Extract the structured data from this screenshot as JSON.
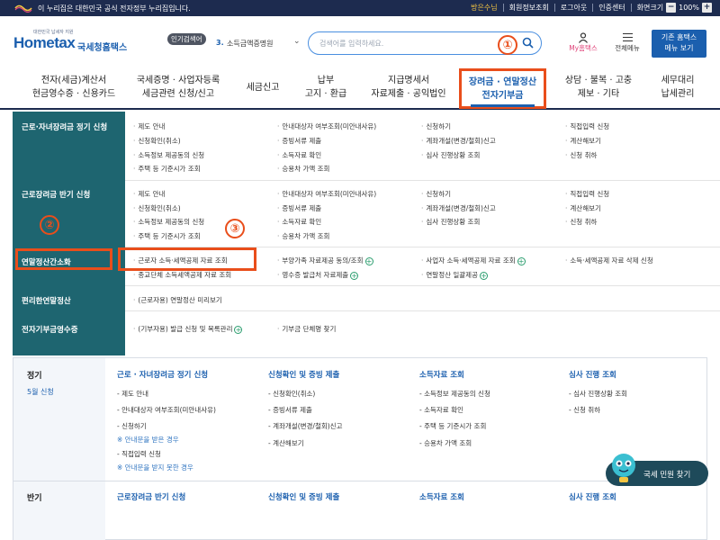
{
  "govbar": {
    "text": "이 누리집은 대한민국 공식 전자정부 누리집입니다.",
    "user": "방은수님",
    "links": [
      "회원정보조회",
      "로그아웃",
      "인증센터",
      "화면크기"
    ],
    "zoom": "100%",
    "zoom_minus": "−",
    "zoom_plus": "+"
  },
  "logo": {
    "small": "대한민국 납세자 지원",
    "home": "Hometax",
    "name": "국세청홈택스"
  },
  "popular": {
    "tag": "인기검색어",
    "rank": "3.",
    "item": "소득금액증명원"
  },
  "search": {
    "placeholder": "검색어를 입력하세요."
  },
  "markers": {
    "m1": "①",
    "m2": "②",
    "m3": "③"
  },
  "header": {
    "myhome": "My홈택스",
    "allmenu": "전체메뉴",
    "basic_line1": "기존 홈택스",
    "basic_line2": "메뉴 보기"
  },
  "gnb": {
    "items": [
      {
        "l1": "전자(세금)계산서",
        "l2": "현금영수증 · 신용카드"
      },
      {
        "l1": "국세증명 · 사업자등록",
        "l2": "세금관련 신청/신고"
      },
      {
        "l1": "세금신고",
        "l2": ""
      },
      {
        "l1": "납부",
        "l2": "고지 · 환급"
      },
      {
        "l1": "지급명세서",
        "l2": "자료제출 · 공익법인"
      },
      {
        "l1": "장려금 · 연말정산",
        "l2": "전자기부금"
      },
      {
        "l1": "상담 · 불복 · 고충",
        "l2": "제보 · 기타"
      },
      {
        "l1": "세무대리",
        "l2": "납세관리"
      }
    ]
  },
  "menu": {
    "sections": [
      {
        "title": "근로·자녀장려금 정기 신청",
        "col1": [
          "제도 안내",
          "신청확인(취소)",
          "소득정보 제공동의 신청",
          "주택 등 기준시가 조회"
        ],
        "col2": [
          "안내대상자 여부조회(미안내사유)",
          "증빙서류 제출",
          "소득자료 확인",
          "승용차 가액 조회"
        ],
        "col3": [
          "신청하기",
          "계좌개설(변경/철회)신고",
          "심사 진행상황 조회"
        ],
        "col4": [
          "직접입력 신청",
          "계산해보기",
          "신청 취하"
        ]
      },
      {
        "title": "근로장려금 반기 신청",
        "col1": [
          "제도 안내",
          "신청확인(취소)",
          "소득정보 제공동의 신청",
          "주택 등 기준시가 조회"
        ],
        "col2": [
          "안내대상자 여부조회(미안내사유)",
          "증빙서류 제출",
          "소득자료 확인",
          "승용차 가액 조회"
        ],
        "col3": [
          "신청하기",
          "계좌개설(변경/철회)신고",
          "심사 진행상황 조회"
        ],
        "col4": [
          "직접입력 신청",
          "계산해보기",
          "신청 취하"
        ]
      },
      {
        "title": "연말정산간소화",
        "col1": [
          "근로자 소득·세액공제 자료 조회",
          "종교단체 소득세액공제 자료 조회"
        ],
        "col2": [
          "부양가족 자료제공 동의/조회",
          "영수증 발급처 자료제출"
        ],
        "col3": [
          "사업자 소득·세액공제 자료 조회",
          "연말정산 일괄제공"
        ],
        "col4": [
          "소득·세액공제 자료 삭제 신청"
        ]
      },
      {
        "title": "편리한연말정산",
        "col1": [
          "(근로자용) 연말정산 미리보기"
        ]
      },
      {
        "title": "전자기부금영수증",
        "col1": [
          "(기부자용) 발급 신청 및 목록관리"
        ],
        "col2": [
          "기부금 단체명 찾기"
        ]
      }
    ]
  },
  "lower": {
    "regular": {
      "label": "정기",
      "sub": "5월 신청"
    },
    "half": {
      "label": "반기"
    },
    "cols": [
      {
        "head": "근로 · 자녀장려금 정기 신청",
        "items": [
          "제도 안내",
          "안내대상자 여부조회(미안내사유)",
          "신청하기"
        ],
        "note1": "※ 안내문을 받은 경우",
        "item_after": "직접입력 신청",
        "note2": "※ 안내문을 받지 못한 경우"
      },
      {
        "head": "신청확인 및 증빙 제출",
        "items": [
          "신청확인(취소)",
          "증빙서류 제출",
          "계좌개설(변경/철회)신고",
          "계산해보기"
        ]
      },
      {
        "head": "소득자료 조회",
        "items": [
          "소득정보 제공동의 신청",
          "소득자료 확인",
          "주택 등 기준시가 조회",
          "승용차 가액 조회"
        ]
      },
      {
        "head": "심사 진행 조회",
        "items": [
          "심사 진행상황 조회",
          "신청 취하"
        ]
      }
    ],
    "cols2": [
      "근로장려금 반기 신청",
      "신청확인 및 증빙 제출",
      "소득자료 조회",
      "심사 진행 조회"
    ]
  },
  "chatbot": {
    "label": "국세 민원 찾기"
  },
  "colors": {
    "navy": "#1d2b4f",
    "brand": "#1b5fae",
    "teal": "#1e6570",
    "highlight": "#e94e1b"
  }
}
